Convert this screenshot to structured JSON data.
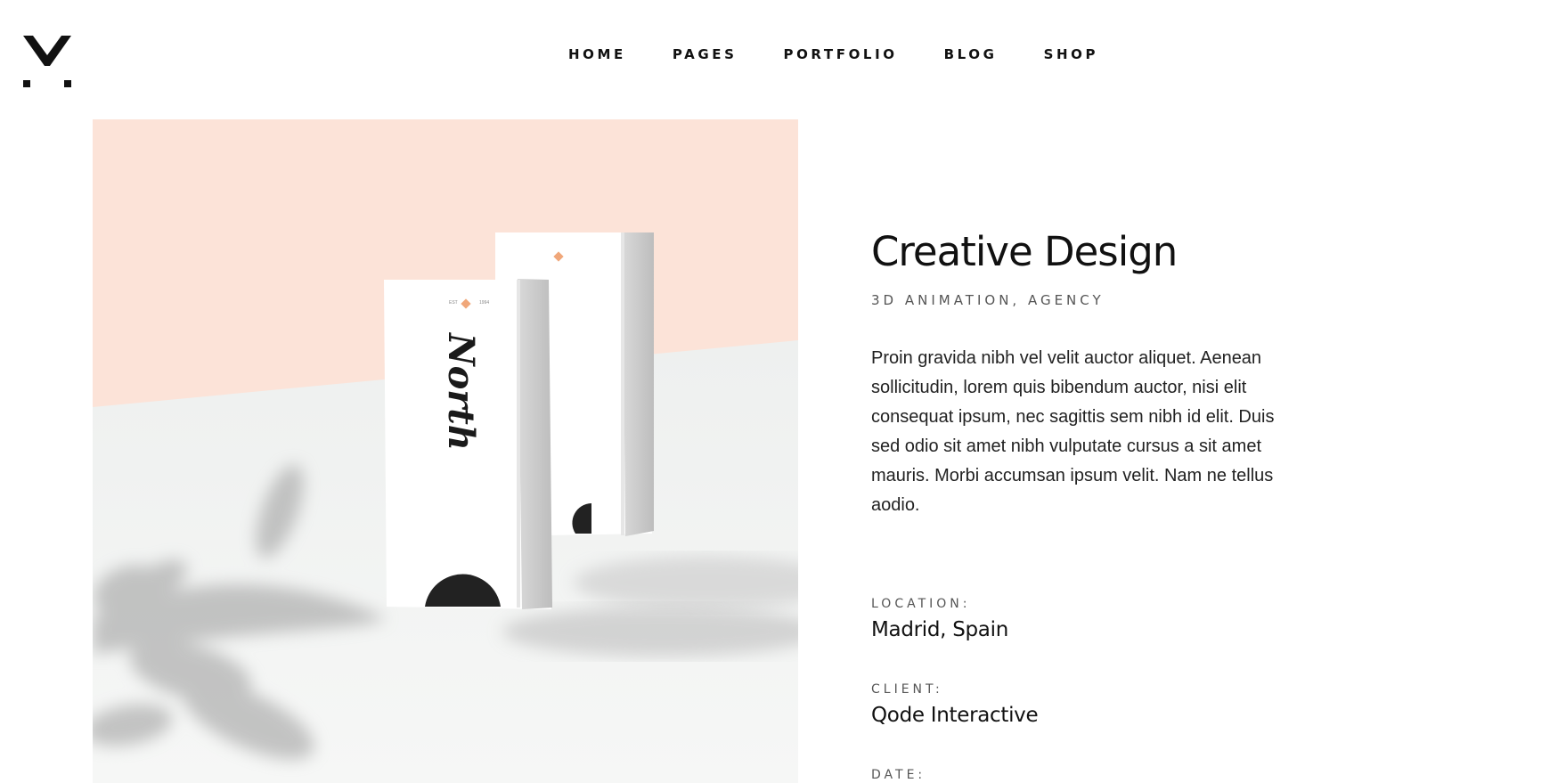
{
  "header": {
    "logo_icon": "v-dots-logo",
    "nav": [
      "HOME",
      "PAGES",
      "PORTFOLIO",
      "BLOG",
      "SHOP"
    ]
  },
  "hero": {
    "image_icon": "north-packaging-mockup",
    "box_brand_text": "North",
    "colors": {
      "peach": "#fce3d8",
      "floor": "#f3f4f3",
      "box": "#ffffff",
      "accent": "#f0a77a",
      "dark": "#222222"
    }
  },
  "project": {
    "title": "Creative Design",
    "subtitle": "3D ANIMATION, AGENCY",
    "description": "Proin gravida nibh vel velit auctor aliquet. Aenean sollicitudin, lorem quis bibendum auctor, nisi elit consequat ipsum, nec sagittis sem nibh id elit. Duis sed odio sit amet nibh vulputate cursus a sit amet mauris. Morbi accumsan ipsum velit. Nam ne tellus aodio.",
    "details": [
      {
        "label": "LOCATION:",
        "value": "Madrid, Spain"
      },
      {
        "label": "CLIENT:",
        "value": "Qode Interactive"
      },
      {
        "label": "DATE:",
        "value": ""
      }
    ]
  }
}
